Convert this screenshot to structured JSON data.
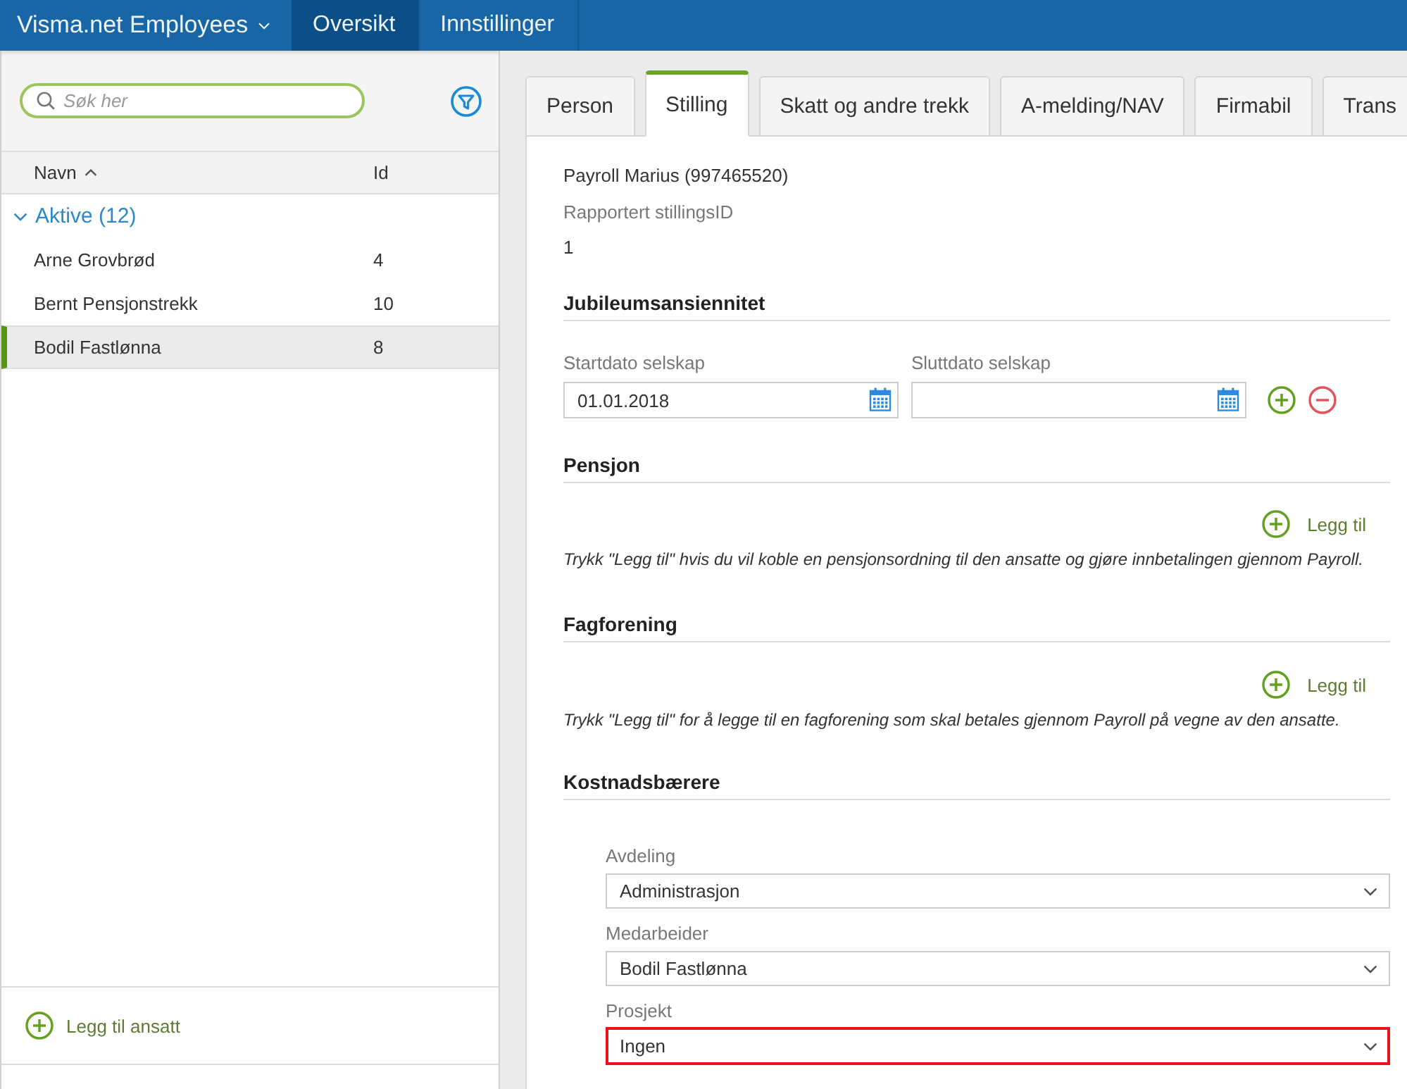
{
  "app_bar": {
    "brand": "Visma.net Employees",
    "nav": [
      {
        "label": "Oversikt",
        "selected": true
      },
      {
        "label": "Innstillinger",
        "selected": false
      }
    ]
  },
  "sidebar": {
    "search": {
      "placeholder": "Søk her"
    },
    "columns": [
      {
        "label": "Navn",
        "sorted": true
      },
      {
        "label": "Id",
        "sorted": false
      }
    ],
    "groups": [
      {
        "label": "Aktive (12)",
        "expanded": true,
        "rows": [
          {
            "name": "Arne Grovbrød",
            "id": "4",
            "selected": false
          },
          {
            "name": "Bernt Pensjonstrekk",
            "id": "10",
            "selected": false
          },
          {
            "name": "Bodil Fastlønna",
            "id": "8",
            "selected": true
          }
        ]
      }
    ],
    "add_button": "Legg til ansatt"
  },
  "tabs": [
    {
      "label": "Person",
      "selected": false
    },
    {
      "label": "Stilling",
      "selected": true
    },
    {
      "label": "Skatt og andre trekk",
      "selected": false
    },
    {
      "label": "A-melding/NAV",
      "selected": false
    },
    {
      "label": "Firmabil",
      "selected": false
    },
    {
      "label": "Trans",
      "selected": false
    }
  ],
  "content": {
    "employer": "Payroll Marius (997465520)",
    "reported_id_label": "Rapportert stillingsID",
    "reported_id": "1",
    "sections": [
      {
        "kind": "dates",
        "title": "Jubileumsansiennitet",
        "fields": [
          {
            "label": "Startdato selskap",
            "value": "01.01.2018"
          },
          {
            "label": "Sluttdato selskap"
          }
        ]
      },
      {
        "kind": "add",
        "title": "Pensjon",
        "action": "Legg til",
        "note": "Trykk \"Legg til\" hvis du vil koble en pensjonsordning til den ansatte og gjøre innbetalingen gjennom Payroll."
      },
      {
        "kind": "add",
        "title": "Fagforening",
        "action": "Legg til",
        "note": "Trykk \"Legg til\" for å legge til en fagforening som skal betales gjennom Payroll på vegne av den ansatte."
      },
      {
        "kind": "selects",
        "title": "Kostnadsbærere",
        "fields": [
          {
            "label": "Avdeling",
            "value": "Administrasjon",
            "highlighted": false
          },
          {
            "label": "Medarbeider",
            "value": "Bodil Fastlønna",
            "highlighted": false
          },
          {
            "label": "Prosjekt",
            "value": "Ingen",
            "highlighted": true
          }
        ]
      }
    ]
  }
}
